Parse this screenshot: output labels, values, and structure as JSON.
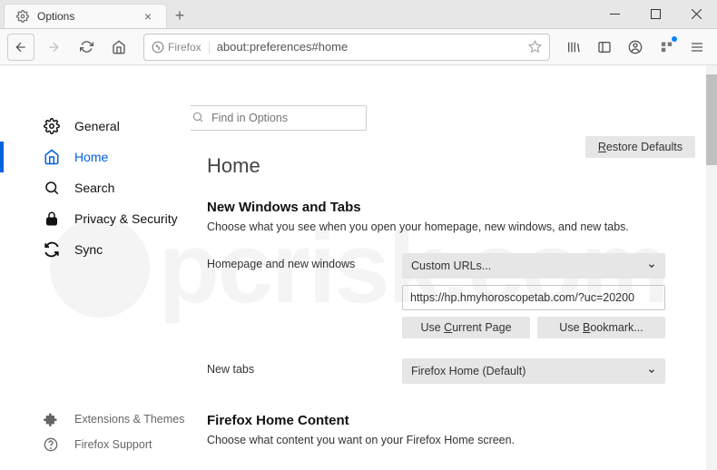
{
  "titlebar": {
    "tab_title": "Options"
  },
  "toolbar": {
    "identity_label": "Firefox",
    "url": "about:preferences#home"
  },
  "search": {
    "placeholder": "Find in Options"
  },
  "sidebar": {
    "items": [
      {
        "label": "General"
      },
      {
        "label": "Home"
      },
      {
        "label": "Search"
      },
      {
        "label": "Privacy & Security"
      },
      {
        "label": "Sync"
      }
    ],
    "bottom": [
      {
        "label": "Extensions & Themes"
      },
      {
        "label": "Firefox Support"
      }
    ]
  },
  "page": {
    "title": "Home",
    "restore_label": "Restore Defaults",
    "section1_title": "New Windows and Tabs",
    "section1_desc": "Choose what you see when you open your homepage, new windows, and new tabs.",
    "homepage_label": "Homepage and new windows",
    "homepage_select": "Custom URLs...",
    "homepage_url": "https://hp.hmyhoroscopetab.com/?uc=20200",
    "use_current": "Use Current Page",
    "use_bookmark": "Use Bookmark...",
    "newtabs_label": "New tabs",
    "newtabs_select": "Firefox Home (Default)",
    "section2_title": "Firefox Home Content",
    "section2_desc": "Choose what content you want on your Firefox Home screen."
  }
}
